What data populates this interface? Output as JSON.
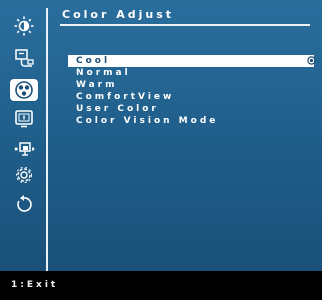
{
  "header": {
    "title": "Color Adjust"
  },
  "sidebar": {
    "icons": [
      {
        "name": "brightness-contrast-icon"
      },
      {
        "name": "input-source-icon"
      },
      {
        "name": "color-icon",
        "active": true
      },
      {
        "name": "display-icon"
      },
      {
        "name": "pip-icon"
      },
      {
        "name": "settings-icon"
      },
      {
        "name": "reset-icon"
      }
    ]
  },
  "menu": {
    "items": [
      {
        "label": "Cool",
        "selected": true
      },
      {
        "label": "Normal"
      },
      {
        "label": "Warm"
      },
      {
        "label": "ComfortView"
      },
      {
        "label": "User Color"
      },
      {
        "label": "Color Vision Mode"
      }
    ]
  },
  "footer": {
    "hint": "1:Exit"
  },
  "colors": {
    "panel": "#1f5d89",
    "highlight": "#ffffff",
    "selected_text": "#1d4f78",
    "footer_bg": "#000000"
  }
}
